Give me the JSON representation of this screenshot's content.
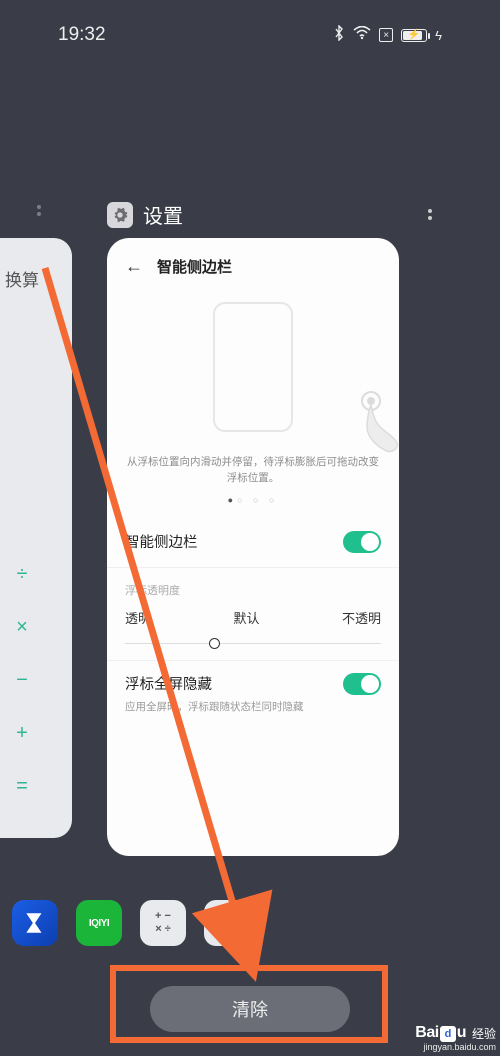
{
  "status": {
    "time": "19:32"
  },
  "left_card": {
    "title": "换算",
    "ops": [
      "÷",
      "×",
      "−",
      "+",
      "="
    ]
  },
  "app": {
    "name": "设置",
    "card": {
      "title": "智能侧边栏",
      "hint": "从浮标位置向内滑动并停留，待浮标膨胀后可拖动改变浮标位置。",
      "toggle_label": "智能侧边栏",
      "opacity_section": "浮标透明度",
      "opacity_labels": {
        "left": "透明",
        "mid": "默认",
        "right": "不透明"
      },
      "fullscreen_hide": {
        "title": "浮标全屏隐藏",
        "subtitle": "应用全屏时，浮标跟随状态栏同时隐藏"
      }
    }
  },
  "bottom_apps": {
    "iqiyi": "IQIYI"
  },
  "clear_button": "清除",
  "watermark": {
    "brand": "Baidu",
    "suffix": "经验",
    "url": "jingyan.baidu.com"
  }
}
